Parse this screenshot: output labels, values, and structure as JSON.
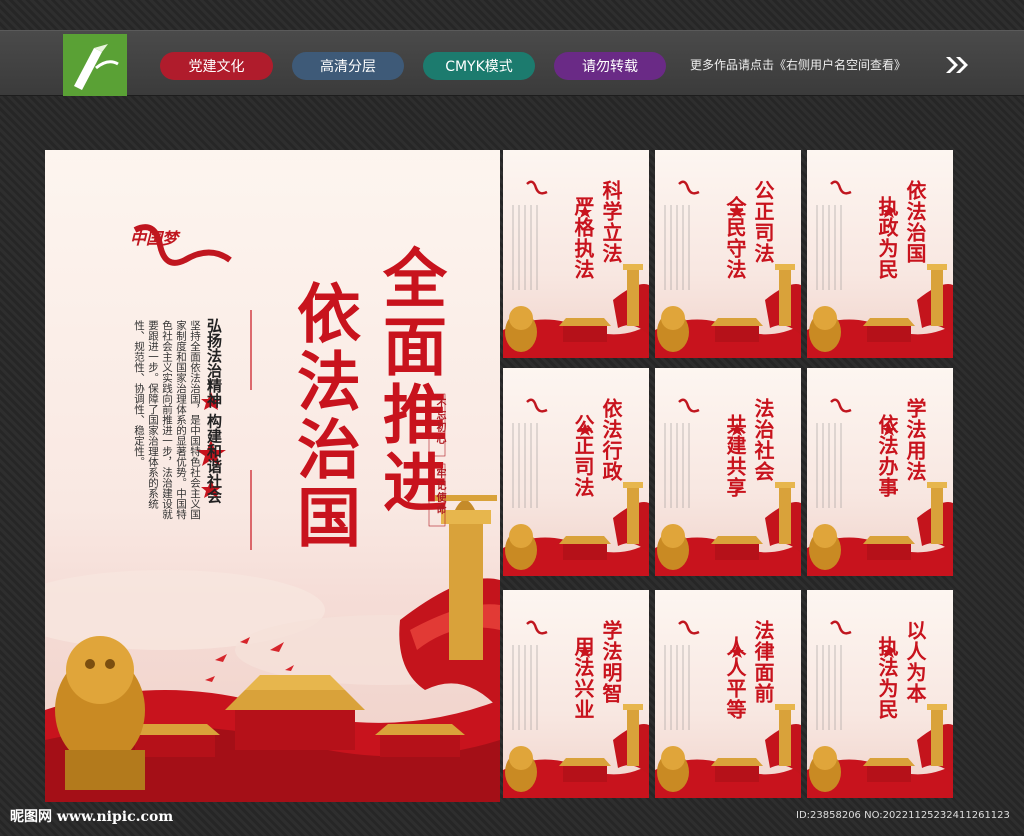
{
  "header": {
    "tags": [
      "党建文化",
      "高清分层",
      "CMYK模式",
      "请勿转载"
    ],
    "more_text": "更多作品请点击《右侧用户名空间查看》",
    "tag_colors": [
      "#b01c2c",
      "#3e5a78",
      "#1c7b6e",
      "#6a2a86"
    ]
  },
  "main_poster": {
    "title_col1": "全面推进",
    "title_col2": "依法治国",
    "subtitle": "弘扬法治精神  构建和谐社会",
    "body": "坚持全面依法治国，是中国特色社会主义国家制度和国家治理体系的显著优势。中国特色社会主义实践向前推进一步，法治建设就要跟进一步。保障了国家治理体系的系统性、规范性、协调性、稳定性。",
    "slogan_a": "不忘初心",
    "slogan_b": "牢记使命",
    "logo_text": "中国梦"
  },
  "small_posters": [
    {
      "title": "科学立法 严格执法"
    },
    {
      "title": "公正司法 全民守法"
    },
    {
      "title": "依法治国 执政为民"
    },
    {
      "title": "依法行政 公正司法"
    },
    {
      "title": "法治社会 共建共享"
    },
    {
      "title": "学法用法 依法办事"
    },
    {
      "title": "学法明智 用法兴业"
    },
    {
      "title": "法律面前 人人平等"
    },
    {
      "title": "以人为本 执法为民"
    }
  ],
  "footer": {
    "site": "昵图网 www.nipic.com",
    "id_text": "ID:23858206 NO:20221125232411261123"
  },
  "colors": {
    "accent_red": "#c8131d",
    "gold": "#d9a23a"
  }
}
